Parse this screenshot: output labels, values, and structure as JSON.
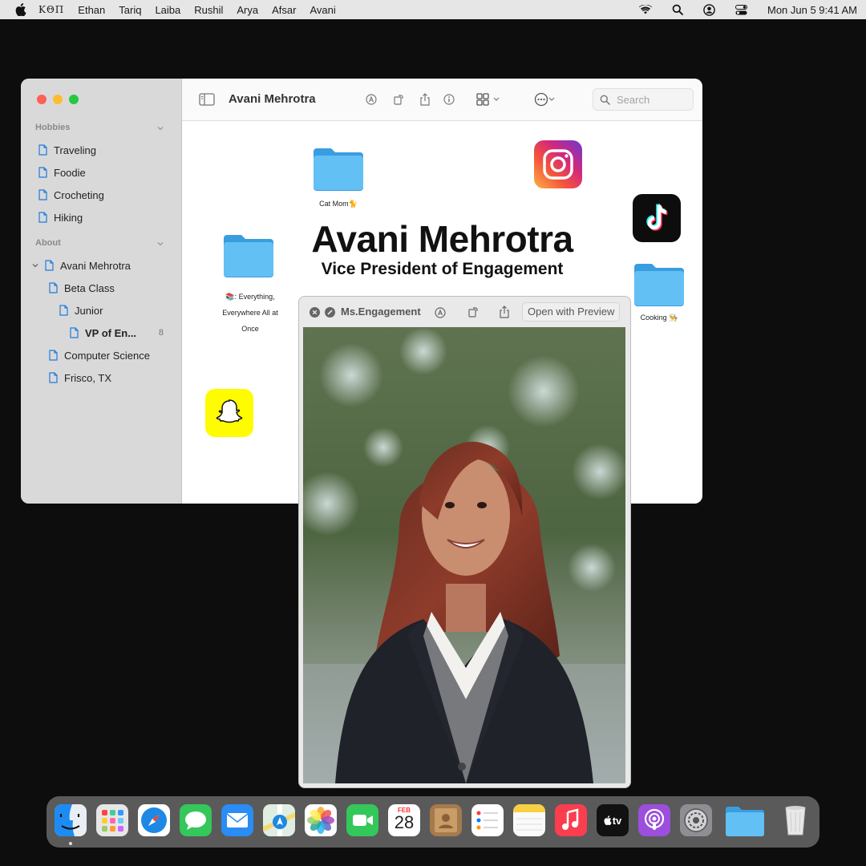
{
  "menubar": {
    "app_name": "KΘΠ",
    "items": [
      "Ethan",
      "Tariq",
      "Laiba",
      "Rushil",
      "Arya",
      "Afsar",
      "Avani"
    ],
    "clock": "Mon Jun 5  9:41 AM"
  },
  "finder": {
    "title": "Avani Mehrotra",
    "search_placeholder": "Search",
    "sidebar": {
      "sections": [
        {
          "label": "Hobbies",
          "items": [
            "Traveling",
            "Foodie",
            "Crocheting",
            "Hiking"
          ]
        },
        {
          "label": "About"
        }
      ],
      "tree": {
        "root": "Avani Mehrotra",
        "beta_class": "Beta Class",
        "junior": "Junior",
        "vp": "VP of En...",
        "vp_badge": "8",
        "cs": "Computer Science",
        "frisco": "Frisco, TX"
      }
    },
    "content": {
      "name": "Avani Mehrotra",
      "role": "Vice President of Engagement",
      "folders": {
        "cat_mom": "Cat Mom🐈",
        "everything_line1": "📚: Everything,",
        "everything_line2": "Everywhere All at",
        "everything_line3": "Once",
        "cooking": "Cooking 👨‍🍳"
      }
    }
  },
  "quicklook": {
    "title": "Ms.Engagement",
    "open_button": "Open with Preview"
  },
  "dock": {
    "calendar_month": "FEB",
    "calendar_day": "28",
    "tv_label": "tv"
  },
  "colors": {
    "folder_blue": "#5ab8f0",
    "accent": "#1f7ce0"
  }
}
